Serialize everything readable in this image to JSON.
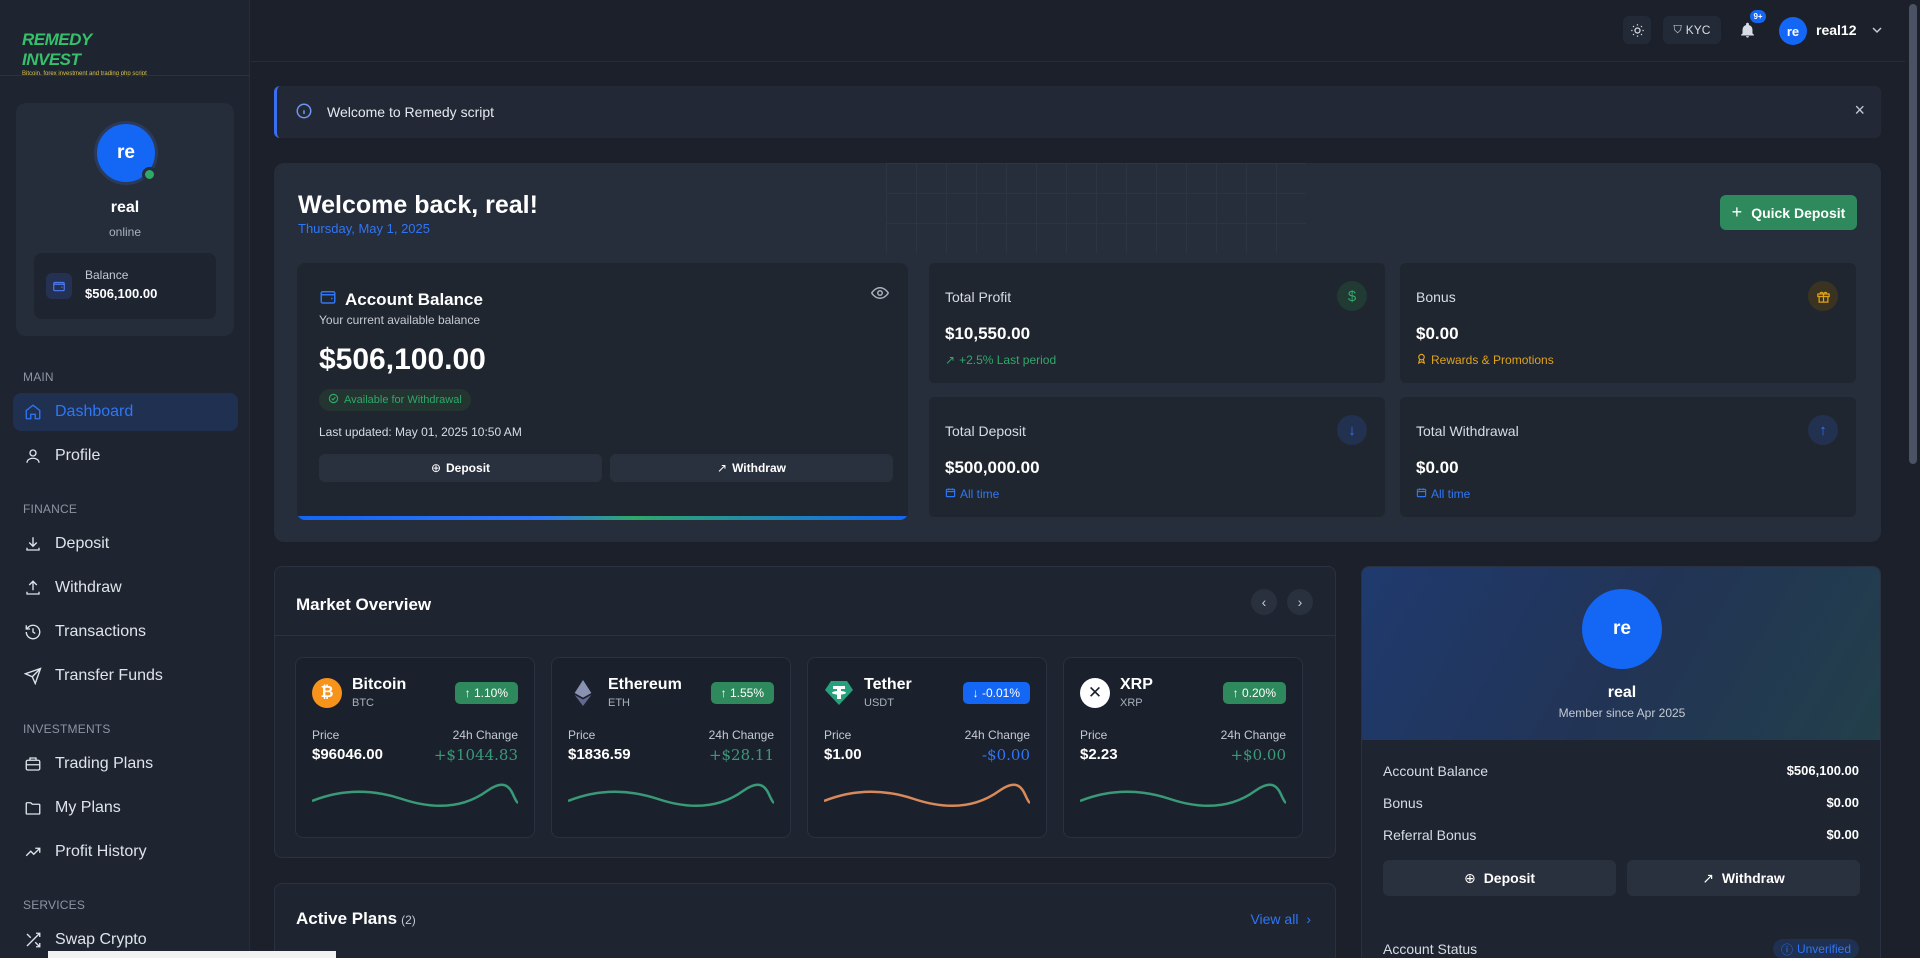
{
  "brand": {
    "logo_text": "REMEDY INVEST",
    "logo_tagline": "Bitcoin, forex investment and trading php script"
  },
  "sidebar": {
    "user": {
      "avatar": "re",
      "name": "real",
      "status": "online",
      "balance_label": "Balance",
      "balance_value": "$506,100.00"
    },
    "sections": [
      {
        "title": "MAIN",
        "items": [
          {
            "label": "Dashboard",
            "icon": "home-icon",
            "active": true
          },
          {
            "label": "Profile",
            "icon": "user-icon"
          }
        ]
      },
      {
        "title": "FINANCE",
        "items": [
          {
            "label": "Deposit",
            "icon": "download-icon"
          },
          {
            "label": "Withdraw",
            "icon": "upload-icon"
          },
          {
            "label": "Transactions",
            "icon": "history-icon"
          },
          {
            "label": "Transfer Funds",
            "icon": "send-icon"
          }
        ]
      },
      {
        "title": "INVESTMENTS",
        "items": [
          {
            "label": "Trading Plans",
            "icon": "briefcase-icon"
          },
          {
            "label": "My Plans",
            "icon": "folder-icon"
          },
          {
            "label": "Profit History",
            "icon": "trend-up-icon"
          }
        ]
      },
      {
        "title": "SERVICES",
        "items": [
          {
            "label": "Swap Crypto",
            "icon": "shuffle-icon"
          }
        ]
      }
    ]
  },
  "topbar": {
    "kyc_label": "KYC",
    "notif_badge": "9+",
    "avatar": "re",
    "username": "real12"
  },
  "alert": {
    "text": "Welcome to Remedy script",
    "close": "×"
  },
  "welcome": {
    "title": "Welcome back, real!",
    "date": "Thursday, May 1, 2025",
    "quick_deposit": "Quick Deposit",
    "account": {
      "title": "Account Balance",
      "subtitle": "Your current available balance",
      "amount": "$506,100.00",
      "available": "Available for Withdrawal",
      "updated": "Last updated: May 01, 2025 10:50 AM",
      "deposit_btn": "Deposit",
      "withdraw_btn": "Withdraw"
    },
    "stats": [
      {
        "label": "Total Profit",
        "value": "$10,550.00",
        "sub": "+2.5% Last period",
        "icon": "$",
        "color": "#2fa86a",
        "icon_bg": "#213a33",
        "sub_icon": "↗"
      },
      {
        "label": "Bonus",
        "value": "$0.00",
        "sub": "Rewards & Promotions",
        "icon": "🎁",
        "color": "#e0a21a",
        "icon_bg": "#3a3322",
        "sub_icon": "♙"
      },
      {
        "label": "Total Deposit",
        "value": "$500,000.00",
        "sub": "All time",
        "icon": "↓",
        "color": "#2f76f6",
        "icon_bg": "#233150",
        "sub_icon": "▣"
      },
      {
        "label": "Total Withdrawal",
        "value": "$0.00",
        "sub": "All time",
        "icon": "↑",
        "color": "#2f76f6",
        "icon_bg": "#233150",
        "sub_icon": "▣"
      }
    ]
  },
  "market": {
    "title": "Market Overview",
    "price_label": "Price",
    "change_label": "24h Change",
    "coins": [
      {
        "name": "Bitcoin",
        "symbol": "BTC",
        "badge": "↑ 1.10%",
        "price": "$96046.00",
        "change": "+$1044.83",
        "up": true,
        "logo": "₿",
        "logo_bg": "#f7931a",
        "spark": "#3a9a78"
      },
      {
        "name": "Ethereum",
        "symbol": "ETH",
        "badge": "↑ 1.55%",
        "price": "$1836.59",
        "change": "+$28.11",
        "up": true,
        "logo": "◆",
        "logo_bg": "#1b212c",
        "spark": "#3a9a78"
      },
      {
        "name": "Tether",
        "symbol": "USDT",
        "badge": "↓ -0.01%",
        "price": "$1.00",
        "change": "-$0.00",
        "up": false,
        "logo": "₮",
        "logo_bg": "#26a17b",
        "spark": "#d98a5a"
      },
      {
        "name": "XRP",
        "symbol": "XRP",
        "badge": "↑ 0.20%",
        "price": "$2.23",
        "change": "+$0.00",
        "up": true,
        "logo": "✕",
        "logo_bg": "#ffffff",
        "spark": "#3a9a78"
      }
    ]
  },
  "plans": {
    "title": "Active Plans",
    "count": "(2)",
    "view_all": "View all"
  },
  "profile_card": {
    "avatar": "re",
    "name": "real",
    "since": "Member since Apr 2025",
    "rows": [
      {
        "label": "Account Balance",
        "value": "$506,100.00"
      },
      {
        "label": "Bonus",
        "value": "$0.00"
      },
      {
        "label": "Referral Bonus",
        "value": "$0.00"
      }
    ],
    "deposit_btn": "Deposit",
    "withdraw_btn": "Withdraw",
    "status_label": "Account Status",
    "status_value": "Unverified"
  },
  "colors": {
    "accent": "#1466f5",
    "success": "#2fa86a",
    "warning": "#e0a21a",
    "bg": "#1b202b"
  }
}
